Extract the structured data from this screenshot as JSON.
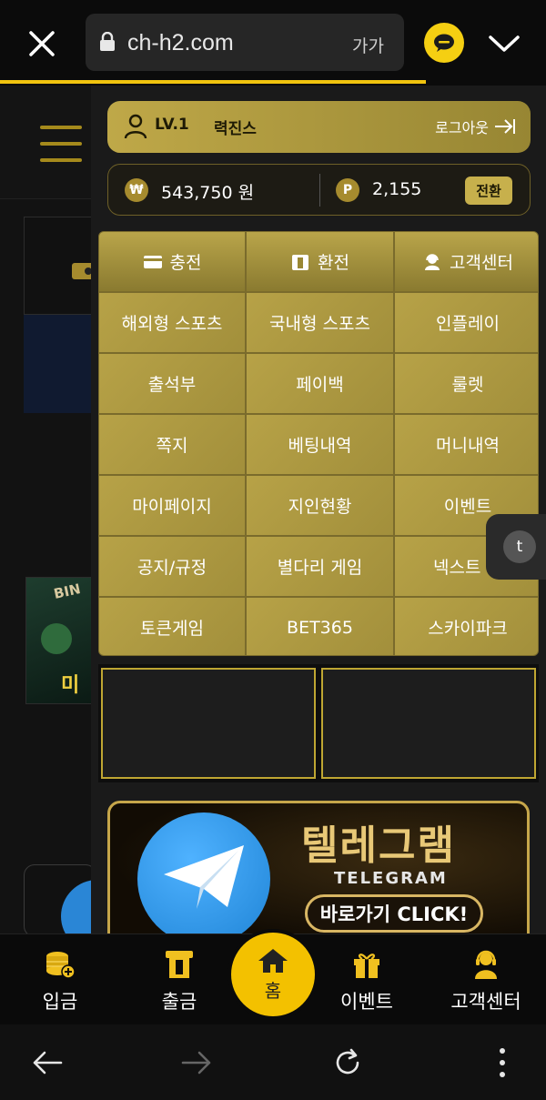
{
  "browser": {
    "url": "ch-h2.com",
    "text_size_label": "가가",
    "progress_fraction": 0.78,
    "accent": "#f1c40f"
  },
  "user": {
    "level": "LV.1",
    "name": "력진스",
    "logout_label": "로그아웃"
  },
  "balance": {
    "won_symbol": "₩",
    "money": "543,750 원",
    "point_symbol": "P",
    "points": "2,155",
    "convert_label": "전환"
  },
  "menu": {
    "top": [
      {
        "label": "충전",
        "icon": "card-icon"
      },
      {
        "label": "환전",
        "icon": "atm-icon"
      },
      {
        "label": "고객센터",
        "icon": "agent-icon"
      }
    ],
    "items": [
      "해외형 스포츠",
      "국내형 스포츠",
      "인플레이",
      "출석부",
      "페이백",
      "룰렛",
      "쪽지",
      "베팅내역",
      "머니내역",
      "마이페이지",
      "지인현황",
      "이벤트",
      "공지/규정",
      "별다리 게임",
      "넥스트 게",
      "토큰게임",
      "BET365",
      "스카이파크"
    ]
  },
  "telegram_banner": {
    "title": "텔레그램",
    "subtitle": "TELEGRAM",
    "button": "바로가기 CLICK!"
  },
  "floating_button": "t",
  "bottom_nav": [
    {
      "label": "입금",
      "icon": "coins-icon"
    },
    {
      "label": "출금",
      "icon": "atm-icon"
    },
    {
      "label": "홈",
      "icon": "home-icon"
    },
    {
      "label": "이벤트",
      "icon": "gift-icon"
    },
    {
      "label": "고객센터",
      "icon": "agent-icon"
    }
  ],
  "colors": {
    "gold": "#b7a247",
    "dark": "#1a1a1a",
    "home_yellow": "#f3c100"
  }
}
